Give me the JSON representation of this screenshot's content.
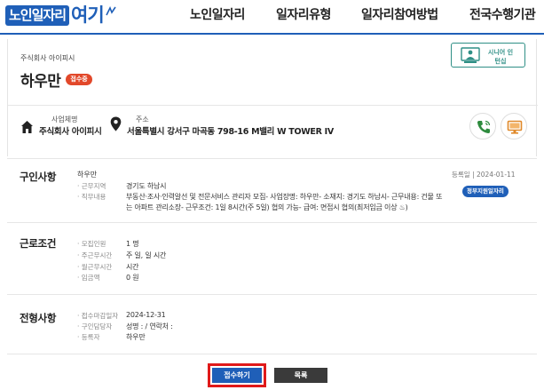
{
  "header": {
    "logo_box": "노인일자리",
    "logo_text": "여기",
    "nav": [
      "노인일자리",
      "일자리유형",
      "일자리참여방법",
      "전국수행기관"
    ]
  },
  "job": {
    "company_small": "주식회사 아이피시",
    "name": "하우만",
    "status_badge": "접수중",
    "senior_button": "시니어 인턴십",
    "business_label": "사업체명",
    "business_value": "주식회사 아이피시",
    "address_label": "주소",
    "address_value": "서울특별시 강서구 마곡동 798-16 M밸리 W TOWER IV",
    "icons": [
      "phone-icon",
      "monitor-icon"
    ]
  },
  "recruit": {
    "title": "구인사항",
    "job_name": "하우만",
    "registered": "등록일 | 2024-01-11",
    "gov_badge": "정부지원일자리",
    "rows": [
      {
        "label": "· 근무지역",
        "value": "경기도 하남시"
      },
      {
        "label": "· 직무내용",
        "value": "부동산·조사·인력알선 및 전문서비스 관리자 모집- 사업장명: 하우만- 소재지: 경기도 하남시- 근무내용: 건물 또"
      },
      {
        "label": "",
        "value": "는 아파트 관리소장- 근무조건: 1일 8시간(주 5일) 협의 가능- 급여: 면접시 협의(최저임금 이상 ♨)"
      }
    ]
  },
  "conditions": {
    "title": "근로조건",
    "rows": [
      {
        "label": "· 모집인원",
        "value": "1 명"
      },
      {
        "label": "· 주근무시간",
        "value": "주 일, 일 시간"
      },
      {
        "label": "· 월근무시간",
        "value": "시간"
      },
      {
        "label": "· 임금액",
        "value": "0 원"
      }
    ]
  },
  "selection": {
    "title": "전형사항",
    "rows": [
      {
        "label": "· 접수마감일자",
        "value": "2024-12-31"
      },
      {
        "label": "· 구인담당자",
        "value": "성명 : / 연락처 :"
      },
      {
        "label": "· 등록자",
        "value": "하우만"
      }
    ]
  },
  "buttons": {
    "apply": "접수하기",
    "list": "목록"
  },
  "colors": {
    "primary": "#1f5fb8",
    "status_red": "#e2482a",
    "teal": "#2f8f86",
    "highlight": "#e01a1a"
  }
}
